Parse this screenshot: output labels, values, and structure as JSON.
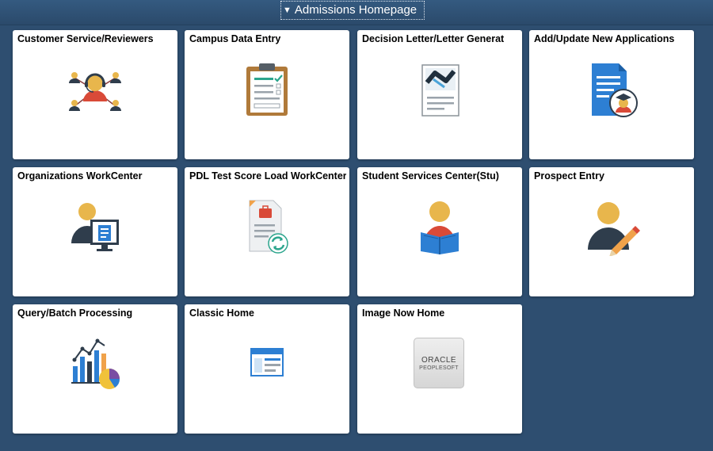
{
  "header": {
    "title": "Admissions Homepage",
    "caret_icon": "triangle-down-icon"
  },
  "tiles": [
    {
      "title": "Customer Service/Reviewers",
      "icon": "support-network-icon"
    },
    {
      "title": "Campus Data Entry",
      "icon": "clipboard-checklist-icon"
    },
    {
      "title": "Decision Letter/Letter Generat",
      "icon": "handshake-document-icon"
    },
    {
      "title": "Add/Update New Applications",
      "icon": "graduate-document-icon"
    },
    {
      "title": "Organizations WorkCenter",
      "icon": "user-monitor-icon"
    },
    {
      "title": "PDL Test Score Load WorkCenter",
      "icon": "document-refresh-icon"
    },
    {
      "title": "Student Services Center(Stu)",
      "icon": "student-reading-icon"
    },
    {
      "title": "Prospect Entry",
      "icon": "user-pencil-icon"
    },
    {
      "title": "Query/Batch Processing",
      "icon": "bar-line-pie-chart-icon"
    },
    {
      "title": "Classic Home",
      "icon": "browser-window-icon"
    },
    {
      "title": "Image Now Home",
      "icon": "oracle-peoplesoft-logo-icon",
      "logo_line1": "ORACLE",
      "logo_line2": "PEOPLESOFT"
    }
  ]
}
